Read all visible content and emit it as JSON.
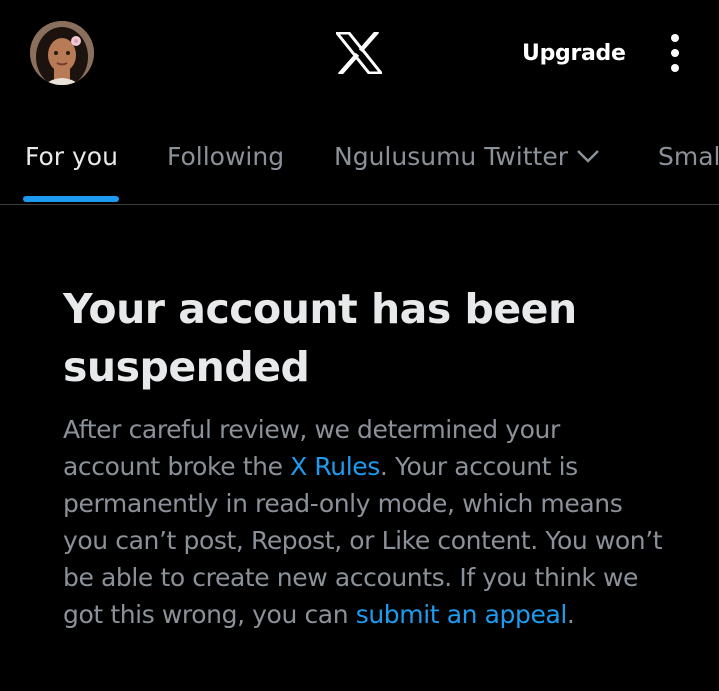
{
  "header": {
    "avatar_icon": "user-avatar",
    "logo_icon": "x-logo",
    "upgrade_label": "Upgrade",
    "more_icon": "more-vertical-icon"
  },
  "tabs": [
    {
      "label": "For you",
      "active": true
    },
    {
      "label": "Following",
      "active": false
    },
    {
      "label": "Ngulusumu Twitter",
      "active": false,
      "icon": "chevron-down-icon"
    },
    {
      "label": "Smal",
      "active": false
    }
  ],
  "notice": {
    "title": "Your account has been suspended",
    "body_1": "After careful review, we determined your account broke the ",
    "rules_link": "X Rules",
    "body_2": ". Your account is permanently in read-only mode, which means you can’t post, Repost, or Like content. You won’t be able to create new accounts. If you think we got this wrong, you can ",
    "appeal_link": "submit an appeal",
    "body_3": "."
  },
  "colors": {
    "background": "#000000",
    "text_primary": "#e7e9ea",
    "text_secondary": "#8b9198",
    "accent": "#1d9bf0",
    "divider": "#3a3d41"
  }
}
